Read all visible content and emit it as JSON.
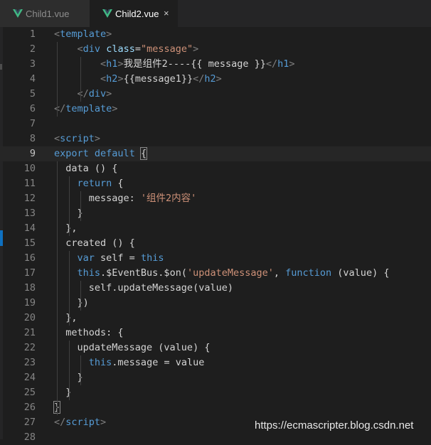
{
  "tabs": [
    {
      "label": "Child1.vue",
      "active": false
    },
    {
      "label": "Child2.vue",
      "active": true,
      "close_glyph": "×"
    }
  ],
  "colors": {
    "vue_logo_green": "#41b883",
    "vue_logo_dark": "#35495e",
    "keyword": "#569cd6",
    "string": "#ce9178",
    "text": "#d4d4d4"
  },
  "current_line": 9,
  "lines": [
    {
      "n": "1",
      "tokens": [
        {
          "t": "<",
          "c": "brk"
        },
        {
          "t": "template",
          "c": "tag"
        },
        {
          "t": ">",
          "c": "brk"
        }
      ]
    },
    {
      "n": "2",
      "tokens": [
        {
          "t": "    "
        },
        {
          "t": "<",
          "c": "brk"
        },
        {
          "t": "div",
          "c": "tag"
        },
        {
          "t": " "
        },
        {
          "t": "class",
          "c": "attr"
        },
        {
          "t": "=",
          "c": "txt"
        },
        {
          "t": "\"message\"",
          "c": "str"
        },
        {
          "t": ">",
          "c": "brk"
        }
      ]
    },
    {
      "n": "3",
      "tokens": [
        {
          "t": "        "
        },
        {
          "t": "<",
          "c": "brk"
        },
        {
          "t": "h1",
          "c": "tag"
        },
        {
          "t": ">",
          "c": "brk"
        },
        {
          "t": "我是组件2----{{ message }}",
          "c": "txt"
        },
        {
          "t": "</",
          "c": "brk"
        },
        {
          "t": "h1",
          "c": "tag"
        },
        {
          "t": ">",
          "c": "brk"
        }
      ]
    },
    {
      "n": "4",
      "tokens": [
        {
          "t": "        "
        },
        {
          "t": "<",
          "c": "brk"
        },
        {
          "t": "h2",
          "c": "tag"
        },
        {
          "t": ">",
          "c": "brk"
        },
        {
          "t": "{{message1}}",
          "c": "txt"
        },
        {
          "t": "</",
          "c": "brk"
        },
        {
          "t": "h2",
          "c": "tag"
        },
        {
          "t": ">",
          "c": "brk"
        }
      ]
    },
    {
      "n": "5",
      "tokens": [
        {
          "t": "    "
        },
        {
          "t": "</",
          "c": "brk"
        },
        {
          "t": "div",
          "c": "tag"
        },
        {
          "t": ">",
          "c": "brk"
        }
      ]
    },
    {
      "n": "6",
      "tokens": [
        {
          "t": "</",
          "c": "brk"
        },
        {
          "t": "template",
          "c": "tag"
        },
        {
          "t": ">",
          "c": "brk"
        }
      ]
    },
    {
      "n": "7",
      "tokens": []
    },
    {
      "n": "8",
      "tokens": [
        {
          "t": "<",
          "c": "brk"
        },
        {
          "t": "script",
          "c": "tag"
        },
        {
          "t": ">",
          "c": "brk"
        }
      ]
    },
    {
      "n": "9",
      "tokens": [
        {
          "t": "export",
          "c": "kw"
        },
        {
          "t": " "
        },
        {
          "t": "default",
          "c": "kw"
        },
        {
          "t": " "
        },
        {
          "t": "{",
          "c": "txt",
          "box": true
        }
      ]
    },
    {
      "n": "10",
      "tokens": [
        {
          "t": "  data () {",
          "c": "txt"
        }
      ]
    },
    {
      "n": "11",
      "tokens": [
        {
          "t": "    "
        },
        {
          "t": "return",
          "c": "kw"
        },
        {
          "t": " {",
          "c": "txt"
        }
      ]
    },
    {
      "n": "12",
      "tokens": [
        {
          "t": "      message: ",
          "c": "txt"
        },
        {
          "t": "'组件2内容'",
          "c": "str"
        }
      ]
    },
    {
      "n": "13",
      "tokens": [
        {
          "t": "    }",
          "c": "txt"
        }
      ]
    },
    {
      "n": "14",
      "tokens": [
        {
          "t": "  },",
          "c": "txt"
        }
      ]
    },
    {
      "n": "15",
      "tokens": [
        {
          "t": "  created () {",
          "c": "txt"
        }
      ]
    },
    {
      "n": "16",
      "tokens": [
        {
          "t": "    "
        },
        {
          "t": "var",
          "c": "kw"
        },
        {
          "t": " self = ",
          "c": "txt"
        },
        {
          "t": "this",
          "c": "kw"
        }
      ]
    },
    {
      "n": "17",
      "tokens": [
        {
          "t": "    "
        },
        {
          "t": "this",
          "c": "kw"
        },
        {
          "t": ".$EventBus.$on(",
          "c": "txt"
        },
        {
          "t": "'updateMessage'",
          "c": "str"
        },
        {
          "t": ", ",
          "c": "txt"
        },
        {
          "t": "function",
          "c": "kw"
        },
        {
          "t": " (value) {",
          "c": "txt"
        }
      ]
    },
    {
      "n": "18",
      "tokens": [
        {
          "t": "      self.updateMessage(value)",
          "c": "txt"
        }
      ]
    },
    {
      "n": "19",
      "tokens": [
        {
          "t": "    })",
          "c": "txt"
        }
      ]
    },
    {
      "n": "20",
      "tokens": [
        {
          "t": "  },",
          "c": "txt"
        }
      ]
    },
    {
      "n": "21",
      "tokens": [
        {
          "t": "  methods: {",
          "c": "txt"
        }
      ]
    },
    {
      "n": "22",
      "tokens": [
        {
          "t": "    updateMessage (value) {",
          "c": "txt"
        }
      ]
    },
    {
      "n": "23",
      "tokens": [
        {
          "t": "      "
        },
        {
          "t": "this",
          "c": "kw"
        },
        {
          "t": ".message = value",
          "c": "txt"
        }
      ]
    },
    {
      "n": "24",
      "tokens": [
        {
          "t": "    }",
          "c": "txt"
        }
      ]
    },
    {
      "n": "25",
      "tokens": [
        {
          "t": "  }",
          "c": "txt"
        }
      ]
    },
    {
      "n": "26",
      "tokens": [
        {
          "t": "}",
          "c": "txt",
          "box": true
        }
      ]
    },
    {
      "n": "27",
      "tokens": [
        {
          "t": "</",
          "c": "brk"
        },
        {
          "t": "script",
          "c": "tag"
        },
        {
          "t": ">",
          "c": "brk"
        }
      ]
    },
    {
      "n": "28",
      "tokens": []
    }
  ],
  "watermark": "https://ecmascripter.blog.csdn.net"
}
